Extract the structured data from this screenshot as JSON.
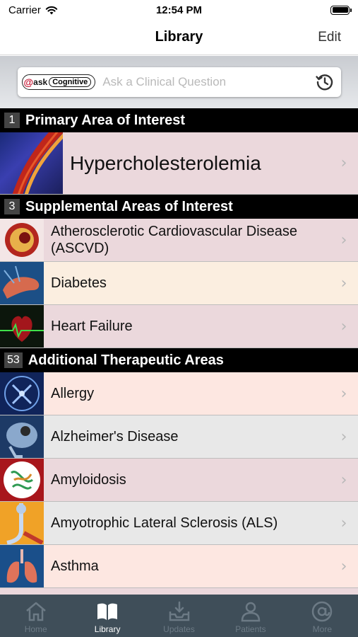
{
  "status_bar": {
    "carrier": "Carrier",
    "time": "12:54 PM"
  },
  "nav": {
    "title": "Library",
    "edit_label": "Edit"
  },
  "search": {
    "logo_ask": "ask",
    "logo_cognitive": "Cognitive",
    "placeholder": "Ask a Clinical Question"
  },
  "sections": {
    "primary": {
      "count": "1",
      "title": "Primary Area of Interest",
      "items": [
        {
          "label": "Hypercholesterolemia"
        }
      ]
    },
    "supplemental": {
      "count": "3",
      "title": "Supplemental Areas of Interest",
      "items": [
        {
          "label": "Atherosclerotic Cardiovascular Disease (ASCVD)"
        },
        {
          "label": "Diabetes"
        },
        {
          "label": "Heart Failure"
        }
      ]
    },
    "additional": {
      "count": "53",
      "title": "Additional Therapeutic Areas",
      "items": [
        {
          "label": "Allergy"
        },
        {
          "label": "Alzheimer's Disease"
        },
        {
          "label": "Amyloidosis"
        },
        {
          "label": "Amyotrophic Lateral Sclerosis (ALS)"
        },
        {
          "label": "Asthma"
        }
      ]
    }
  },
  "tab_bar": {
    "tabs": [
      {
        "label": "Home",
        "icon": "home-icon"
      },
      {
        "label": "Library",
        "icon": "book-icon"
      },
      {
        "label": "Updates",
        "icon": "inbox-download-icon"
      },
      {
        "label": "Patients",
        "icon": "person-icon"
      },
      {
        "label": "More",
        "icon": "at-sign-icon"
      }
    ],
    "active": "Library"
  },
  "colors": {
    "section_header_bg": "#000000",
    "row_pink": "#ebd8dc",
    "row_cream": "#fbeee0",
    "row_peach": "#fde7e1",
    "row_gray": "#e8e8e8",
    "tab_bar_bg": "#3f4e59"
  }
}
